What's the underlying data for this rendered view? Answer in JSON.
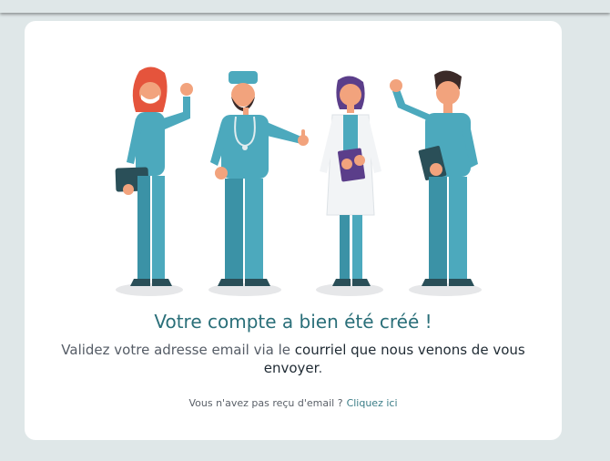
{
  "confirmation": {
    "title": "Votre compte a bien été créé !",
    "message_prefix": "Validez votre adresse email via le",
    "message_strong_1": "courriel que nous venons de vous",
    "message_strong_2": "envoyer",
    "message_suffix": ".",
    "resend_question": "Vous n'avez pas reçu d'email ?",
    "resend_link": "Cliquez ici"
  },
  "illustration": {
    "name": "medical-staff-waving",
    "colors": {
      "scrubs": "#4ca9bd",
      "scrubs_dark": "#2e7f90",
      "skin": "#f2a37d",
      "red_hair": "#e5543c",
      "dark_hair": "#3b2a28",
      "purple_hair": "#5b3e8a",
      "coat": "#f2f4f6",
      "shadow": "#e6e7e9"
    }
  },
  "colors": {
    "page_background": "#dfe7e8",
    "card_background": "#ffffff",
    "title_color": "#2a6f79",
    "link_color": "#3b7d87"
  }
}
